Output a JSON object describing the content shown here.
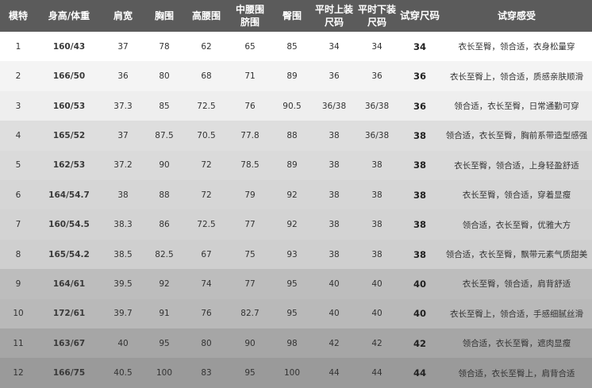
{
  "table": {
    "headers": [
      "模特",
      "身高/体重",
      "肩宽",
      "胸围",
      "高腰围",
      "中腰围\n脐围",
      "臀围",
      "平时上装\n尺码",
      "平时下装\n尺码",
      "试穿尺码",
      "试穿感受"
    ],
    "rows": [
      [
        "1",
        "160/43",
        "37",
        "78",
        "62",
        "65",
        "85",
        "34",
        "34",
        "34",
        "衣长至臀，领合适，衣身松量穿"
      ],
      [
        "2",
        "166/50",
        "36",
        "80",
        "68",
        "71",
        "89",
        "36",
        "36",
        "36",
        "衣长至臀上，领合适，质感亲肤顺滑"
      ],
      [
        "3",
        "160/53",
        "37.3",
        "85",
        "72.5",
        "76",
        "90.5",
        "36/38",
        "36/38",
        "36",
        "领合适，衣长至臀，日常通勤可穿"
      ],
      [
        "4",
        "165/52",
        "37",
        "87.5",
        "70.5",
        "77.8",
        "88",
        "38",
        "36/38",
        "38",
        "领合适，衣长至臀，胸前系带造型感强"
      ],
      [
        "5",
        "162/53",
        "37.2",
        "90",
        "72",
        "78.5",
        "89",
        "38",
        "38",
        "38",
        "衣长至臀，领合适，上身轻盈舒适"
      ],
      [
        "6",
        "164/54.7",
        "38",
        "88",
        "72",
        "79",
        "92",
        "38",
        "38",
        "38",
        "衣长至臀，领合适，穿着显瘦"
      ],
      [
        "7",
        "160/54.5",
        "38.3",
        "86",
        "72.5",
        "77",
        "92",
        "38",
        "38",
        "38",
        "领合适，衣长至臀，优雅大方"
      ],
      [
        "8",
        "165/54.2",
        "38.5",
        "82.5",
        "67",
        "75",
        "93",
        "38",
        "38",
        "38",
        "领合适，衣长至臀，飘带元素气质甜美"
      ],
      [
        "9",
        "164/61",
        "39.5",
        "92",
        "74",
        "77",
        "95",
        "40",
        "40",
        "40",
        "衣长至臀，领合适，肩背舒适"
      ],
      [
        "10",
        "172/61",
        "39.7",
        "91",
        "76",
        "82.7",
        "95",
        "40",
        "40",
        "40",
        "衣长至臀上，领合适，手感细腻丝滑"
      ],
      [
        "11",
        "163/67",
        "40",
        "95",
        "80",
        "90",
        "98",
        "42",
        "42",
        "42",
        "领合适，衣长至臀，遮肉显瘦"
      ],
      [
        "12",
        "166/75",
        "40.5",
        "100",
        "83",
        "95",
        "100",
        "44",
        "44",
        "44",
        "领合适，衣长至臀上，肩背合适"
      ]
    ],
    "row_colors": [
      "#ffffff",
      "#f4f4f4",
      "#eeeeee",
      "#dedede",
      "#dadada",
      "#d6d6d6",
      "#d3d3d3",
      "#cfcfcf",
      "#bdbdbd",
      "#b9b9b9",
      "#a6a6a6",
      "#9a9a9a"
    ],
    "header_color": "#5b5b5b"
  }
}
